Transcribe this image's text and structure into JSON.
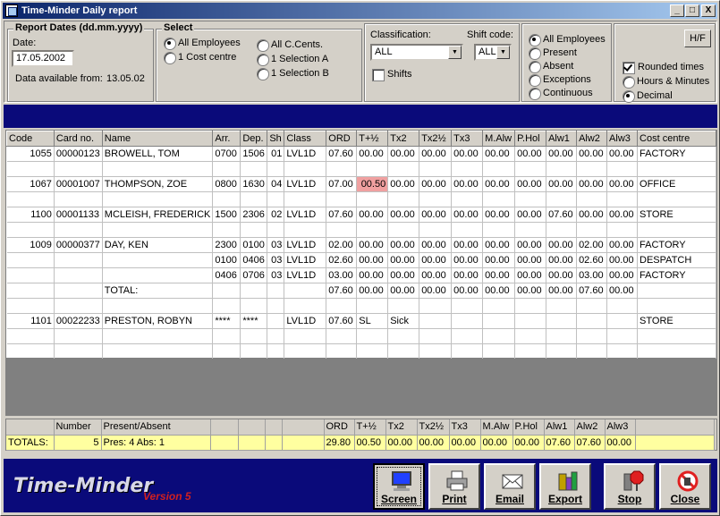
{
  "window": {
    "title": "Time-Minder Daily report",
    "min": "_",
    "max": "□",
    "close": "X"
  },
  "report_dates": {
    "legend": "Report Dates (dd.mm.yyyy)",
    "date_label": "Date:",
    "date_value": "17.05.2002",
    "avail_label": "Data available from:",
    "avail_value": "13.05.02"
  },
  "select": {
    "legend": "Select",
    "opt_all_emp": "All Employees",
    "opt_cost": "1 Cost centre",
    "opt_allcc": "All C.Cents.",
    "opt_selA": "1 Selection A",
    "opt_selB": "1 Selection B"
  },
  "classification": {
    "label": "Classification:",
    "value": "ALL",
    "shifts": "Shifts"
  },
  "shift_code": {
    "label": "Shift code:",
    "value": "ALL"
  },
  "presence": {
    "all": "All Employees",
    "present": "Present",
    "absent": "Absent",
    "exceptions": "Exceptions",
    "continuous": "Continuous"
  },
  "format": {
    "hf": "H/F",
    "rounded": "Rounded times",
    "hours_minutes": "Hours & Minutes",
    "decimal": "Decimal"
  },
  "grid": {
    "columns": [
      "Code",
      "Card no.",
      "Name",
      "Arr.",
      "Dep.",
      "Sh",
      "Class",
      "ORD",
      "T+½",
      "Tx2",
      "Tx2½",
      "Tx3",
      "M.Alw",
      "P.Hol",
      "Alw1",
      "Alw2",
      "Alw3",
      "Cost centre"
    ],
    "rows": [
      [
        "1055",
        "00000123",
        "BROWELL, TOM",
        "0700",
        "1506",
        "01",
        "LVL1D",
        "07.60",
        "00.00",
        "00.00",
        "00.00",
        "00.00",
        "00.00",
        "00.00",
        "00.00",
        "00.00",
        "00.00",
        "FACTORY"
      ],
      [
        "",
        "",
        "",
        "",
        "",
        "",
        "",
        "",
        "",
        "",
        "",
        "",
        "",
        "",
        "",
        "",
        "",
        ""
      ],
      [
        "1067",
        "00001007",
        "THOMPSON, ZOE",
        "0800",
        "1630",
        "04",
        "LVL1D",
        "07.00",
        "00.50",
        "00.00",
        "00.00",
        "00.00",
        "00.00",
        "00.00",
        "00.00",
        "00.00",
        "00.00",
        "OFFICE"
      ],
      [
        "",
        "",
        "",
        "",
        "",
        "",
        "",
        "",
        "",
        "",
        "",
        "",
        "",
        "",
        "",
        "",
        "",
        ""
      ],
      [
        "1100",
        "00001133",
        "MCLEISH, FREDERICK",
        "1500",
        "2306",
        "02",
        "LVL1D",
        "07.60",
        "00.00",
        "00.00",
        "00.00",
        "00.00",
        "00.00",
        "00.00",
        "07.60",
        "00.00",
        "00.00",
        "STORE"
      ],
      [
        "",
        "",
        "",
        "",
        "",
        "",
        "",
        "",
        "",
        "",
        "",
        "",
        "",
        "",
        "",
        "",
        "",
        ""
      ],
      [
        "1009",
        "00000377",
        "DAY, KEN",
        "2300",
        "0100",
        "03",
        "LVL1D",
        "02.00",
        "00.00",
        "00.00",
        "00.00",
        "00.00",
        "00.00",
        "00.00",
        "00.00",
        "02.00",
        "00.00",
        "FACTORY"
      ],
      [
        "",
        "",
        "",
        "0100",
        "0406",
        "03",
        "LVL1D",
        "02.60",
        "00.00",
        "00.00",
        "00.00",
        "00.00",
        "00.00",
        "00.00",
        "00.00",
        "02.60",
        "00.00",
        "DESPATCH"
      ],
      [
        "",
        "",
        "",
        "0406",
        "0706",
        "03",
        "LVL1D",
        "03.00",
        "00.00",
        "00.00",
        "00.00",
        "00.00",
        "00.00",
        "00.00",
        "00.00",
        "03.00",
        "00.00",
        "FACTORY"
      ],
      [
        "",
        "",
        "TOTAL:",
        "",
        "",
        "",
        "",
        "07.60",
        "00.00",
        "00.00",
        "00.00",
        "00.00",
        "00.00",
        "00.00",
        "00.00",
        "07.60",
        "00.00",
        ""
      ],
      [
        "",
        "",
        "",
        "",
        "",
        "",
        "",
        "",
        "",
        "",
        "",
        "",
        "",
        "",
        "",
        "",
        "",
        ""
      ],
      [
        "1101",
        "00022233",
        "PRESTON, ROBYN",
        "****",
        "****",
        "",
        "LVL1D",
        "07.60",
        "SL",
        "Sick",
        "",
        "",
        "",
        "",
        "",
        "",
        "",
        "STORE"
      ],
      [
        "",
        "",
        "",
        "",
        "",
        "",
        "",
        "",
        "",
        "",
        "",
        "",
        "",
        "",
        "",
        "",
        "",
        ""
      ],
      [
        "",
        "",
        "",
        "",
        "",
        "",
        "",
        "",
        "",
        "",
        "",
        "",
        "",
        "",
        "",
        "",
        "",
        ""
      ]
    ]
  },
  "totals": {
    "headers": [
      "",
      "Number",
      "Present/Absent",
      "",
      "",
      "",
      "",
      "ORD",
      "T+½",
      "Tx2",
      "Tx2½",
      "Tx3",
      "M.Alw",
      "P.Hol",
      "Alw1",
      "Alw2",
      "Alw3",
      ""
    ],
    "values": [
      "TOTALS:",
      "5",
      "Pres: 4   Abs: 1",
      "",
      "",
      "",
      "",
      "29.80",
      "00.50",
      "00.00",
      "00.00",
      "00.00",
      "00.00",
      "00.00",
      "07.60",
      "07.60",
      "00.00",
      ""
    ]
  },
  "footer": {
    "brand": "Time-Minder",
    "version": "Version 5",
    "screen": "Screen",
    "print": "Print",
    "email": "Email",
    "export": "Export",
    "stop": "Stop",
    "close": "Close"
  },
  "colors": {
    "highlight": "#f0a0a0",
    "totals_bg": "#ffffa0",
    "navy": "#0a0a7a"
  }
}
